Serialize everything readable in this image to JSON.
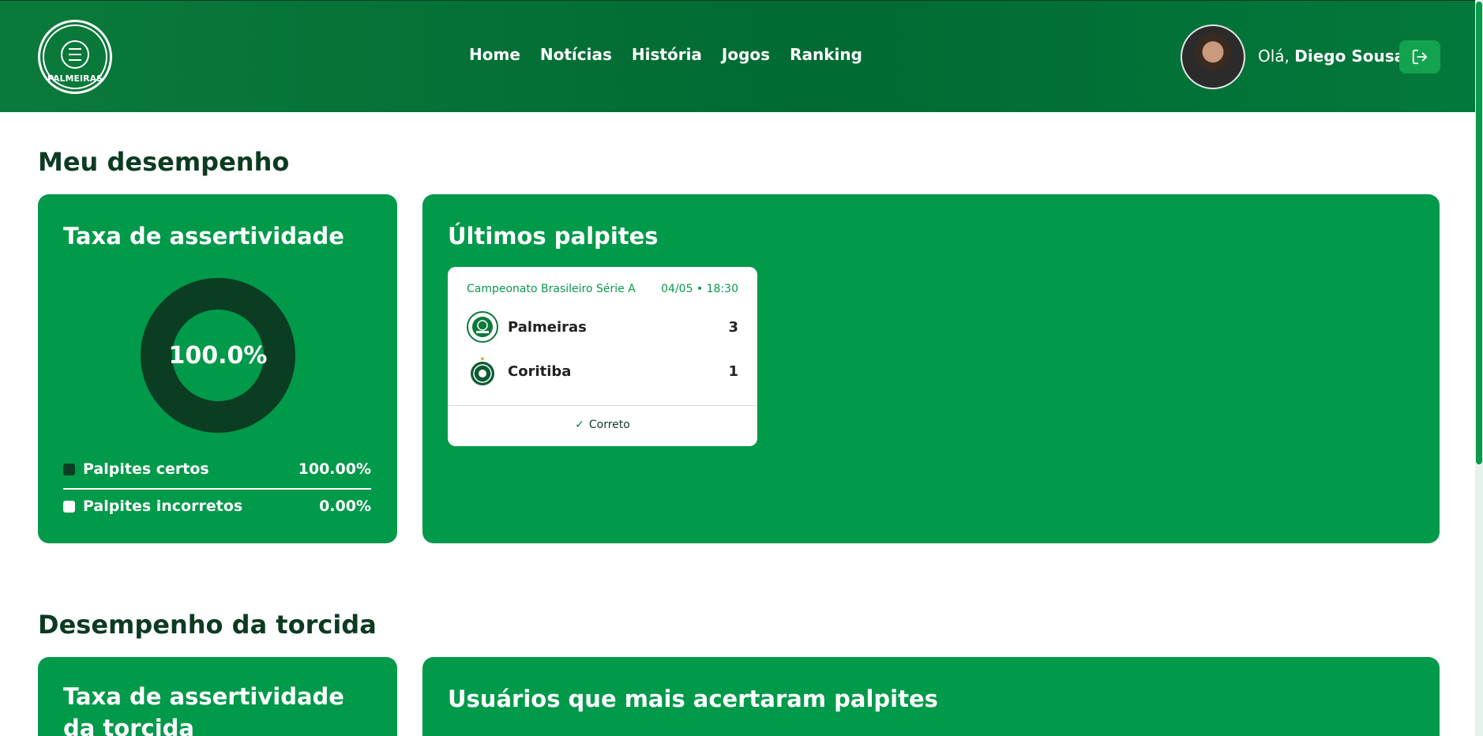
{
  "header": {
    "logo_text": "PALMEIRAS",
    "nav": [
      "Home",
      "Notícias",
      "História",
      "Jogos",
      "Ranking"
    ],
    "greeting_prefix": "Olá,",
    "user_name": "Diego Sousa",
    "logout_icon": "logout-icon"
  },
  "sections": {
    "my_performance": "Meu desempenho",
    "fan_performance": "Desempenho da torcida"
  },
  "accuracy_card": {
    "title": "Taxa de assertividade",
    "center_value": "100.0%",
    "legend": [
      {
        "label": "Palpites certos",
        "value": "100.00%",
        "color": "#0a3d22"
      },
      {
        "label": "Palpites incorretos",
        "value": "0.00%",
        "color": "#ffffff"
      }
    ],
    "fraction_correct": 1.0
  },
  "recent_guesses": {
    "title": "Últimos palpites",
    "items": [
      {
        "competition": "Campeonato Brasileiro Série A",
        "datetime": "04/05 • 18:30",
        "home": {
          "name": "Palmeiras",
          "score": "3"
        },
        "away": {
          "name": "Coritiba",
          "score": "1"
        },
        "status": "Correto"
      }
    ]
  },
  "fan_accuracy_card": {
    "title": "Taxa de assertividade da torcida"
  },
  "top_users_card": {
    "title": "Usuários que mais acertaram palpites"
  },
  "colors": {
    "header": "#006b33",
    "card": "#01994a",
    "dark": "#0a3d22",
    "accent": "#13a24e"
  }
}
